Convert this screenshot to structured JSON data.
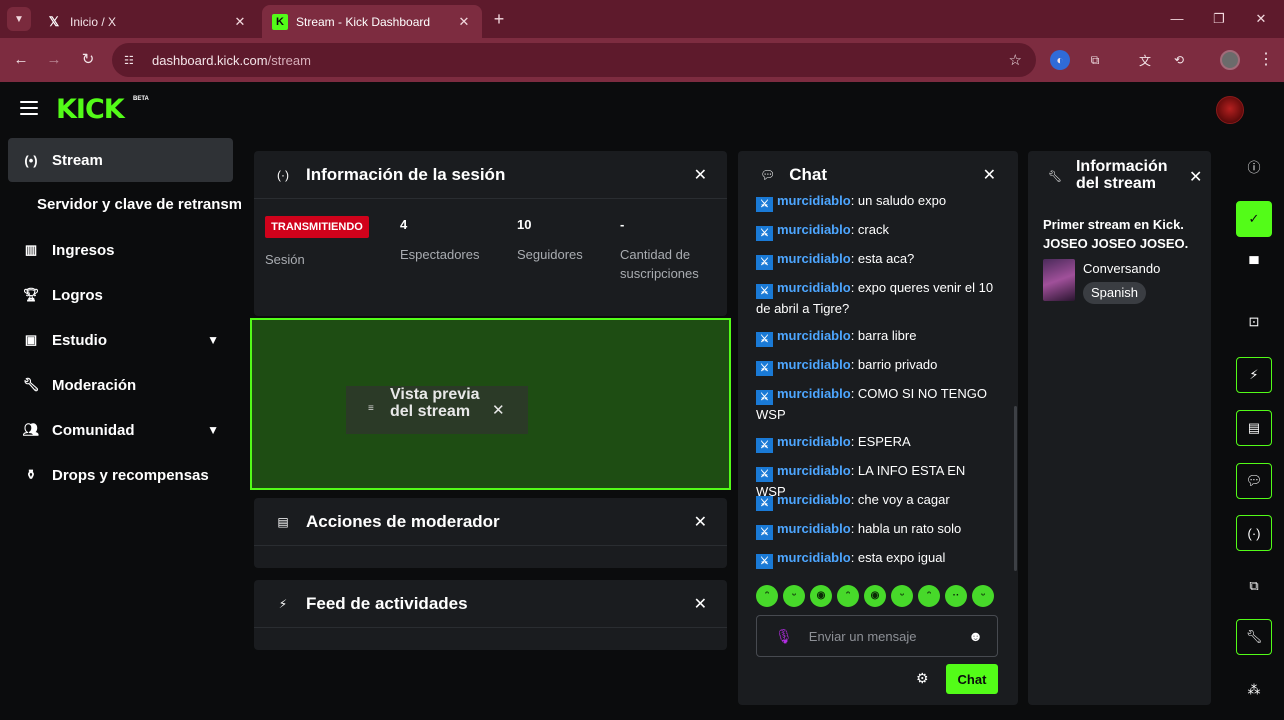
{
  "browser": {
    "tabs": [
      {
        "label": "Inicio / X",
        "favicon": "x-logo"
      },
      {
        "label": "Stream - Kick Dashboard",
        "favicon": "kick-logo"
      }
    ],
    "url_host": "dashboard.kick.com",
    "url_path": "/stream"
  },
  "header": {
    "logo": "KICK",
    "beta": "BETA"
  },
  "sidebar": {
    "items": [
      {
        "label": "Stream",
        "icon": "broadcast-icon"
      },
      {
        "label": "Servidor y clave de retransmisión"
      },
      {
        "label": "Ingresos",
        "icon": "bar-chart-icon"
      },
      {
        "label": "Logros",
        "icon": "trophy-icon"
      },
      {
        "label": "Estudio",
        "icon": "studio-icon"
      },
      {
        "label": "Moderación",
        "icon": "wrench-icon"
      },
      {
        "label": "Comunidad",
        "icon": "users-icon"
      },
      {
        "label": "Drops y recompensas",
        "icon": "drops-icon"
      }
    ]
  },
  "session": {
    "title": "Información de la sesión",
    "live_badge": "TRANSMITIENDO",
    "session_label": "Sesión",
    "viewers_value": "4",
    "viewers_label": "Espectadores",
    "followers_value": "10",
    "followers_label": "Seguidores",
    "subs_value": "-",
    "subs_label": "Cantidad de suscripciones"
  },
  "preview": {
    "label": "Vista previa del stream"
  },
  "mod_actions": {
    "title": "Acciones de moderador"
  },
  "activity": {
    "title": "Feed de actividades"
  },
  "chat": {
    "title": "Chat",
    "messages": [
      {
        "user": "murcidiablo",
        "text": ": un saludo expo"
      },
      {
        "user": "murcidiablo",
        "text": ": crack"
      },
      {
        "user": "murcidiablo",
        "text": ": esta aca?"
      },
      {
        "user": "murcidiablo",
        "text": ": expo queres venir el 10 de abril a Tigre?"
      },
      {
        "user": "murcidiablo",
        "text": ": barra libre"
      },
      {
        "user": "murcidiablo",
        "text": ": barrio privado"
      },
      {
        "user": "murcidiablo",
        "text": ": COMO SI NO TENGO WSP"
      },
      {
        "user": "murcidiablo",
        "text": ": ESPERA"
      },
      {
        "user": "murcidiablo",
        "text": ": LA INFO ESTA EN WSP"
      },
      {
        "user": "murcidiablo",
        "text": ": che voy a cagar"
      },
      {
        "user": "murcidiablo",
        "text": ": habla un rato solo"
      },
      {
        "user": "murcidiablo",
        "text": ": esta expo igual"
      }
    ],
    "placeholder": "Enviar un mensaje",
    "send_label": "Chat"
  },
  "stream_info": {
    "title": "Información del stream",
    "description": "Primer stream en Kick. JOSEO JOSEO JOSEO.",
    "category": "Conversando",
    "language": "Spanish"
  },
  "colors": {
    "accent": "#53fc18",
    "live": "#d0021b",
    "username": "#4da6ff",
    "tabbar": "#5e1a2c"
  }
}
